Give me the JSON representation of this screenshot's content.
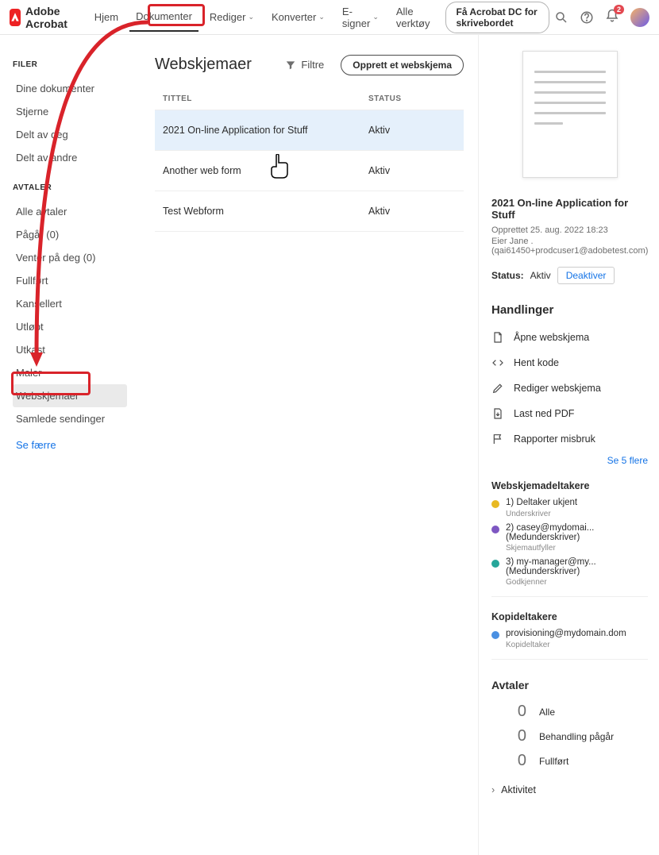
{
  "brand": "Adobe Acrobat",
  "nav": {
    "home": "Hjem",
    "documents": "Dokumenter",
    "edit": "Rediger",
    "convert": "Konverter",
    "esign": "E-signer",
    "alltools": "Alle verktøy",
    "cta": "Få Acrobat DC for skrivebordet"
  },
  "notif_count": "2",
  "sidebar": {
    "files_header": "FILER",
    "files": [
      "Dine dokumenter",
      "Stjerne",
      "Delt av deg",
      "Delt av andre"
    ],
    "agreements_header": "AVTALER",
    "agreements": [
      "Alle avtaler",
      "Pågår (0)",
      "Venter på deg (0)",
      "Fullført",
      "Kansellert",
      "Utløpt",
      "Utkast",
      "Maler",
      "Webskjemaer",
      "Samlede sendinger"
    ],
    "see_fewer": "Se færre"
  },
  "main": {
    "title": "Webskjemaer",
    "filter": "Filtre",
    "create": "Opprett et webskjema",
    "col_title": "TITTEL",
    "col_status": "STATUS",
    "rows": [
      {
        "title": "2021 On-line Application for Stuff",
        "status": "Aktiv"
      },
      {
        "title": "Another web form",
        "status": "Aktiv"
      },
      {
        "title": "Test Webform",
        "status": "Aktiv"
      }
    ]
  },
  "details": {
    "title": "2021 On-line Application for Stuff",
    "created": "Opprettet 25. aug. 2022 18:23",
    "owner": "Eier Jane . (qai61450+prodcuser1@adobetest.com)",
    "status_label": "Status:",
    "status_value": "Aktiv",
    "deactivate": "Deaktiver",
    "actions_header": "Handlinger",
    "actions": [
      "Åpne webskjema",
      "Hent kode",
      "Rediger webskjema",
      "Last ned PDF",
      "Rapporter misbruk"
    ],
    "see_more": "Se 5 flere",
    "participants_header": "Webskjemadeltakere",
    "participants": [
      {
        "label": "1) Deltaker ukjent",
        "role": "Underskriver",
        "color": "#e8b923",
        "extra": ""
      },
      {
        "label": "2) casey@mydomai...",
        "role": "Skjemautfyller",
        "color": "#7e57c2",
        "extra": "(Medunderskriver)"
      },
      {
        "label": "3) my-manager@my...",
        "role": "Godkjenner",
        "color": "#26a69a",
        "extra": "(Medunderskriver)"
      }
    ],
    "copy_header": "Kopideltakere",
    "copy": {
      "label": "provisioning@mydomain.dom",
      "role": "Kopideltaker",
      "color": "#4a90e2"
    },
    "agreements_header": "Avtaler",
    "agreements": [
      {
        "count": "0",
        "label": "Alle"
      },
      {
        "count": "0",
        "label": "Behandling pågår"
      },
      {
        "count": "0",
        "label": "Fullført"
      }
    ],
    "activity": "Aktivitet"
  }
}
